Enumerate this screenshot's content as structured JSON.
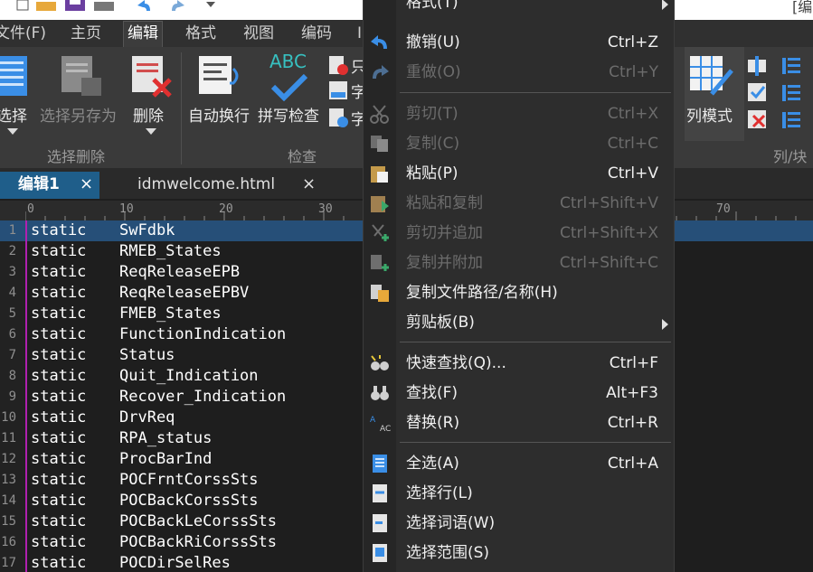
{
  "menubar": {
    "items": [
      {
        "label": "文件(F)"
      },
      {
        "label": "主页"
      },
      {
        "label": "编辑"
      },
      {
        "label": "格式"
      },
      {
        "label": "视图"
      },
      {
        "label": "编码"
      },
      {
        "label": "I"
      }
    ]
  },
  "ribbon": {
    "select_label": "选择",
    "select_save_as_label": "选择另存为",
    "delete_label": "删除",
    "group_select_delete": "选择删除",
    "auto_wrap_label": "自动换行",
    "spell_check_label": "拼写检查",
    "spell_abc": "ABC",
    "side_item_1": "只",
    "side_item_2": "字",
    "side_item_3": "字",
    "group_check": "检查",
    "column_mode_label": "列模式",
    "group_column_block": "列/块",
    "right_title_fragment": "[编"
  },
  "tabs": {
    "active_label": "编辑1",
    "inactive_label": "idmwelcome.html",
    "close_glyph": "×"
  },
  "ruler": {
    "marks": [
      "0",
      "10",
      "20",
      "30",
      "70"
    ]
  },
  "editor": {
    "lines": [
      {
        "num": "1",
        "kw": "static",
        "ident": "SwFdbk"
      },
      {
        "num": "2",
        "kw": "static",
        "ident": "RMEB_States"
      },
      {
        "num": "3",
        "kw": "static",
        "ident": "ReqReleaseEPB"
      },
      {
        "num": "4",
        "kw": "static",
        "ident": "ReqReleaseEPBV"
      },
      {
        "num": "5",
        "kw": "static",
        "ident": "FMEB_States"
      },
      {
        "num": "6",
        "kw": "static",
        "ident": "FunctionIndication"
      },
      {
        "num": "7",
        "kw": "static",
        "ident": "Status"
      },
      {
        "num": "8",
        "kw": "static",
        "ident": "Quit_Indication"
      },
      {
        "num": "9",
        "kw": "static",
        "ident": "Recover_Indication"
      },
      {
        "num": "10",
        "kw": "static",
        "ident": "DrvReq"
      },
      {
        "num": "11",
        "kw": "static",
        "ident": "RPA_status"
      },
      {
        "num": "12",
        "kw": "static",
        "ident": "ProcBarInd"
      },
      {
        "num": "13",
        "kw": "static",
        "ident": "POCFrntCorssSts"
      },
      {
        "num": "14",
        "kw": "static",
        "ident": "POCBackCorssSts"
      },
      {
        "num": "15",
        "kw": "static",
        "ident": "POCBackLeCorssSts"
      },
      {
        "num": "16",
        "kw": "static",
        "ident": "POCBackRiCorssSts"
      },
      {
        "num": "17",
        "kw": "static",
        "ident": "POCDirSelRes"
      }
    ]
  },
  "context_menu": {
    "items": [
      {
        "label": "格式(T)",
        "shortcut": "",
        "submenu": true,
        "disabled": false,
        "icon": "none"
      },
      {
        "label": "撤销(U)",
        "shortcut": "Ctrl+Z",
        "disabled": false,
        "icon": "undo-icon"
      },
      {
        "label": "重做(O)",
        "shortcut": "Ctrl+Y",
        "disabled": true,
        "icon": "redo-icon"
      },
      {
        "label": "剪切(T)",
        "shortcut": "Ctrl+X",
        "disabled": true,
        "icon": "cut-icon"
      },
      {
        "label": "复制(C)",
        "shortcut": "Ctrl+C",
        "disabled": true,
        "icon": "copy-icon"
      },
      {
        "label": "粘贴(P)",
        "shortcut": "Ctrl+V",
        "disabled": false,
        "icon": "paste-icon"
      },
      {
        "label": "粘贴和复制",
        "shortcut": "Ctrl+Shift+V",
        "disabled": true,
        "icon": "paste-copy-icon"
      },
      {
        "label": "剪切并追加",
        "shortcut": "Ctrl+Shift+X",
        "disabled": true,
        "icon": "cut-append-icon"
      },
      {
        "label": "复制并附加",
        "shortcut": "Ctrl+Shift+C",
        "disabled": true,
        "icon": "copy-append-icon"
      },
      {
        "label": "复制文件路径/名称(H)",
        "shortcut": "",
        "disabled": false,
        "icon": "copy-path-icon"
      },
      {
        "label": "剪贴板(B)",
        "shortcut": "",
        "submenu": true,
        "disabled": false,
        "icon": "none"
      },
      {
        "label": "快速查找(Q)...",
        "shortcut": "Ctrl+F",
        "disabled": false,
        "icon": "quick-find-icon"
      },
      {
        "label": "查找(F)",
        "shortcut": "Alt+F3",
        "disabled": false,
        "icon": "find-icon"
      },
      {
        "label": "替换(R)",
        "shortcut": "Ctrl+R",
        "disabled": false,
        "icon": "replace-icon"
      },
      {
        "label": "全选(A)",
        "shortcut": "Ctrl+A",
        "disabled": false,
        "icon": "select-all-icon"
      },
      {
        "label": "选择行(L)",
        "shortcut": "",
        "disabled": false,
        "icon": "select-line-icon"
      },
      {
        "label": "选择词语(W)",
        "shortcut": "",
        "disabled": false,
        "icon": "select-word-icon"
      },
      {
        "label": "选择范围(S)",
        "shortcut": "",
        "disabled": false,
        "icon": "select-range-icon"
      }
    ]
  },
  "colors": {
    "accent_tab": "#1f5e8a",
    "current_line": "#264f78",
    "gutter_bar": "#b020b0",
    "icon_blue": "#3a8ee6"
  }
}
